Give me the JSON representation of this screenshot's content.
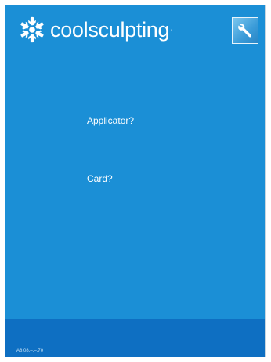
{
  "brand": {
    "logo_icon": "snowflake-icon",
    "name": "coolsculpting",
    "trademark": "·"
  },
  "toolbar": {
    "tools_icon": "wrench-icon"
  },
  "prompts": {
    "applicator": "Applicator?",
    "card": "Card?"
  },
  "footer": {
    "version": "A8.08.–.–.70"
  },
  "colors": {
    "background": "#1b8fd6",
    "footer": "#0e6fc2",
    "text": "#ffffff"
  }
}
